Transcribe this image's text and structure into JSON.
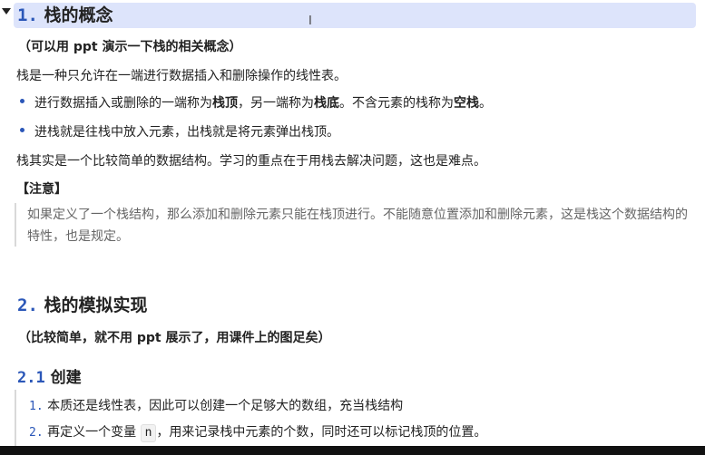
{
  "section1": {
    "number": "1.",
    "title": "栈的概念",
    "note": "（可以用 ppt 演示一下栈的相关概念）",
    "definition": "栈是一种只允许在一端进行数据插入和删除操作的线性表。",
    "bullets": [
      {
        "pre": "进行数据插入或删除的一端称为",
        "b1": "栈顶",
        "mid": "，另一端称为",
        "b2": "栈底",
        "mid2": "。不含元素的栈称为",
        "b3": "空栈",
        "post": "。"
      },
      {
        "text": "进栈就是往栈中放入元素，出栈就是将元素弹出栈顶。"
      }
    ],
    "summary": "栈其实是一个比较简单的数据结构。学习的重点在于用栈去解决问题，这也是难点。",
    "attention_label": "【注意】",
    "quote": "如果定义了一个栈结构，那么添加和删除元素只能在栈顶进行。不能随意位置添加和删除元素，这是栈这个数据结构的特性，也是规定。"
  },
  "section2": {
    "number": "2.",
    "title": "栈的模拟实现",
    "note": "（比较简单，就不用 ppt 展示了，用课件上的图足矣）",
    "sub": {
      "number": "2.1",
      "title": "创建",
      "items": [
        {
          "num": "1.",
          "text": "本质还是线性表，因此可以创建一个足够大的数组，充当栈结构"
        },
        {
          "num": "2.",
          "pre": "再定义一个变量",
          "code": "n",
          "post": "，用来记录栈中元素的个数，同时还可以标记栈顶的位置。"
        }
      ]
    }
  },
  "colors": {
    "heading_bg": "#dde4fb",
    "accent": "#2b57b8",
    "quote_text": "#666666"
  },
  "icons": {
    "collapse": "triangle-down-icon",
    "cursor": "text-cursor-icon"
  }
}
